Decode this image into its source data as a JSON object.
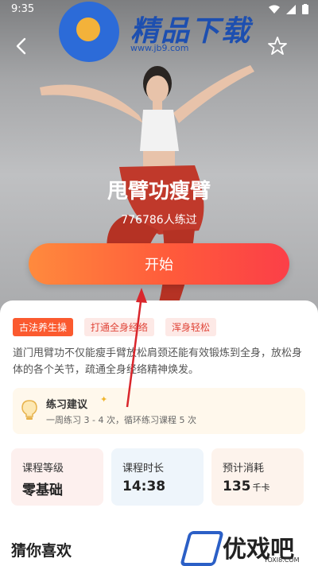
{
  "status_bar": {
    "time": "9:35"
  },
  "watermark_top": {
    "title": "精品下载",
    "url": "www.jb9.com"
  },
  "hero": {
    "course_title": "甩臂功瘦臂",
    "learners": "776786人练过",
    "start_label": "开始"
  },
  "tags": [
    "古法养生操",
    "打通全身经络",
    "浑身轻松"
  ],
  "description": "道门甩臂功不仅能瘦手臂放松肩颈还能有效锻炼到全身，放松身体的各个关节，疏通全身经络精神焕发。",
  "advice": {
    "title": "练习建议",
    "detail": "一周练习 3 - 4 次，循环练习课程 5 次"
  },
  "cards": [
    {
      "label": "课程等级",
      "value": "零基础",
      "unit": ""
    },
    {
      "label": "课程时长",
      "value": "14:38",
      "unit": ""
    },
    {
      "label": "预计消耗",
      "value": "135",
      "unit": "千卡"
    }
  ],
  "section_title": "猜你喜欢",
  "watermark_bottom": {
    "title": "优戏吧",
    "url": "YOXI8.COM"
  },
  "colors": {
    "accent": "#fb5a2f",
    "arrow": "#d9262c"
  }
}
